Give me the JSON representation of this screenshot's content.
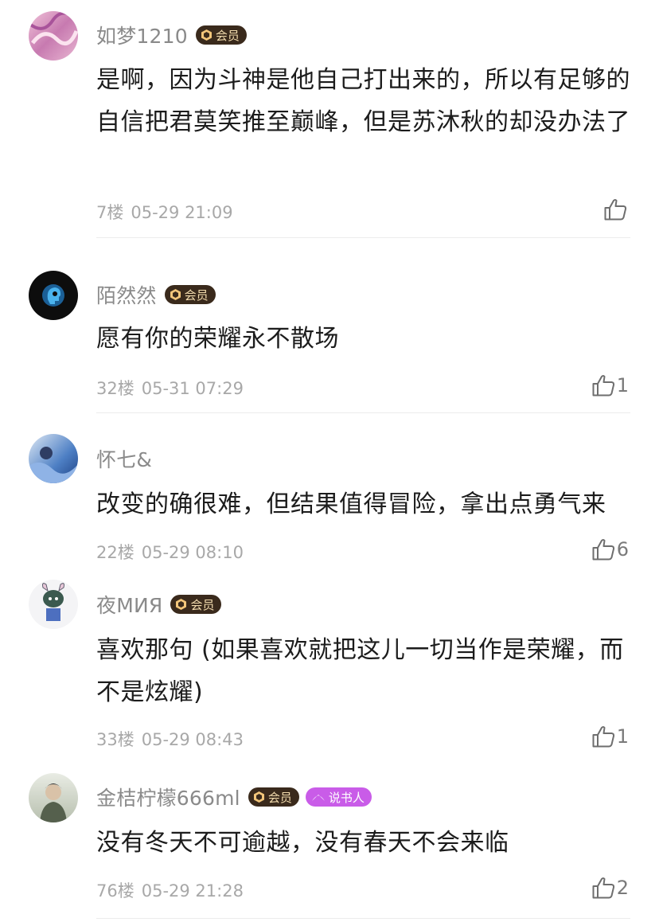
{
  "comments": [
    {
      "username": "如梦1210",
      "badges": {
        "vip": "会员"
      },
      "text": "是啊，因为斗神是他自己打出来的，所以有足够的自信把君莫笑推至巅峰，但是苏沐秋的却没办法了",
      "floor": "7楼",
      "time": "05-29 21:09",
      "likes": ""
    },
    {
      "username": "陌然然",
      "badges": {
        "vip": "会员"
      },
      "text": "愿有你的荣耀永不散场",
      "floor": "32楼",
      "time": "05-31 07:29",
      "likes": "1"
    },
    {
      "username": "怀七&",
      "badges": {},
      "text": "改变的确很难，但结果值得冒险，拿出点勇气来",
      "floor": "22楼",
      "time": "05-29 08:10",
      "likes": "6"
    },
    {
      "username": "夜МИЯ",
      "badges": {
        "vip": "会员"
      },
      "text": "喜欢那句 (如果喜欢就把这儿一切当作是荣耀，而不是炫耀)",
      "floor": "33楼",
      "time": "05-29 08:43",
      "likes": "1"
    },
    {
      "username": "金桔柠檬666ml",
      "badges": {
        "vip": "会员",
        "story": "说书人"
      },
      "text": "没有冬天不可逾越，没有春天不会来临",
      "floor": "76楼",
      "time": "05-29 21:28",
      "likes": "2"
    }
  ],
  "colors": {
    "vip_badge": "#3a2a1c",
    "vip_text": "#f3dcae",
    "story_badge": "#c95ce8"
  },
  "icons": {
    "like": "thumbs-up-icon",
    "vip": "vip-gem-icon",
    "story": "storyteller-fan-icon"
  }
}
